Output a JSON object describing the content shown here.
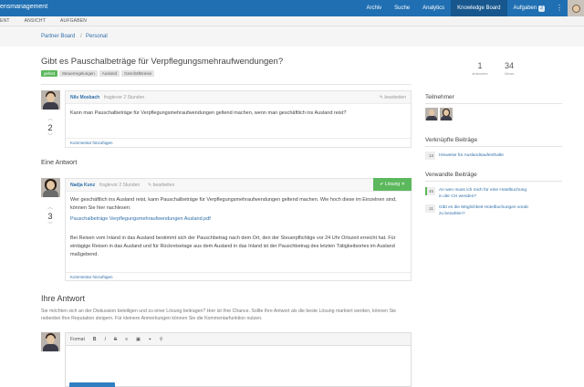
{
  "topbar": {
    "brand": "ensmanagement",
    "nav": [
      "Archiv",
      "Suche",
      "Analytics",
      "Knowledge Board"
    ],
    "tasks_label": "Aufgaben",
    "tasks_count": "2",
    "more": "⋮"
  },
  "subnav": [
    "ENT",
    "ANSICHT",
    "AUFGABEN"
  ],
  "breadcrumb": [
    "Partner Board",
    "Personal"
  ],
  "question": {
    "title": "Gibt es Pauschalbeträge für Verpflegungsmehraufwendungen?",
    "tags": [
      "gelöst",
      "Steuerregelungen",
      "Ausland",
      "Geschäftsreise"
    ],
    "answers_count": "1",
    "answers_label": "antworten",
    "views_count": "34",
    "views_label": "Views",
    "author": "Nils Mosbach",
    "action": "fragte",
    "time": "vor 2 Stunden",
    "edit": "bearbeiten",
    "votes": "2",
    "body": "Kann man Pauschalbeträge für Verpflegungsmehraufwendungen geltend machen, wenn man geschäftlich ins Ausland reist?",
    "comment_link": "Kommentar hinzufügen"
  },
  "answers_heading": "Eine Antwort",
  "answer": {
    "author": "Nadja Kunz",
    "action": "fragte",
    "time": "vor 2 Stunden",
    "edit": "bearbeiten",
    "solution": "Lösung",
    "votes": "3",
    "p1": "Wer geschäftlich ins Ausland reist, kann Pauschalbeträge für Verpflegungsmehraufwendungen geltend machen. Wie hoch diese im Einzelnen sind, können Sie hier nachlesen:",
    "attachment": "Pauschalbeträge Verpflegungsmehraufwendungen Ausland.pdf",
    "p2": "Bei Reisen vom Inland in das Ausland bestimmt sich der Pauschbetrag nach dem Ort, den der Steuerpflichtige vor 24 Uhr Ortszeit erreicht hat. Für eintägige Reisen in das Ausland und für Rückreisetage aus dem Ausland in das Inland ist der Pauschbetrag des letzten Tätigkeitsortes im Ausland maßgebend.",
    "comment_link": "Kommentar hinzufügen"
  },
  "your_answer": {
    "heading": "Ihre Antwort",
    "hint": "Sie möchten sich an der Diskussion beteiligen und zu einer Lösung beitragen? Hier ist Ihre Chance. Sollte Ihre Antwort als die beste Lösung markiert werden, können Sie nebenbei Ihre Reputation steigern. Für kleinere Anmerkungen können Sie die Kommentarfunktion nutzen.",
    "format_label": "Format",
    "tools": [
      "B",
      "I",
      "S",
      "≡",
      "▣",
      "⌖",
      "⚲"
    ]
  },
  "sidebar": {
    "participants_heading": "Teilnehmer",
    "linked_heading": "Verknüpfte Beiträge",
    "linked": [
      {
        "count": "13",
        "title": "Hinweise für Auslandsaufenthalte"
      }
    ],
    "related_heading": "Verwandte Beiträge",
    "related": [
      {
        "count": "45",
        "title": "An wen muss ich mich für eine Hotelbuchung in der CH wenden?"
      },
      {
        "count": "11",
        "title": "Gibt es die Möglichkeit Hotelbuchungen vorab zu bezahlen?"
      }
    ]
  },
  "colors": {
    "primary": "#1f6fb2",
    "active_nav": "#17578e",
    "success": "#5cb85c",
    "link": "#2f6fa8"
  }
}
